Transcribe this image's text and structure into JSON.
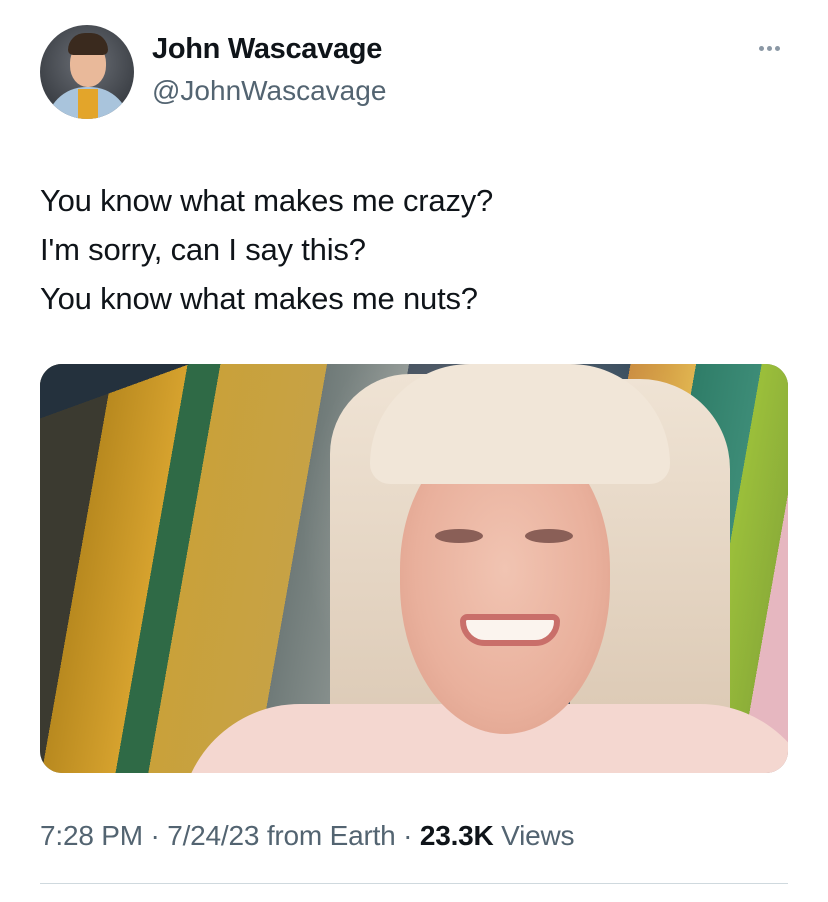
{
  "author": {
    "name": "John Wascavage",
    "handle": "@JohnWascavage"
  },
  "tweet": {
    "lines": [
      "You know what makes me crazy?",
      "I'm sorry, can I say this?",
      "You know what makes me nuts?"
    ],
    "time": "7:28 PM",
    "date": "7/24/23",
    "source": "from Earth",
    "separator": "·",
    "views_count": "23.3K",
    "views_label": "Views"
  },
  "icons": {
    "more": "more-options-icon"
  },
  "colors": {
    "text": "#0f1419",
    "secondary": "#536471",
    "divider": "#cfd9de"
  }
}
